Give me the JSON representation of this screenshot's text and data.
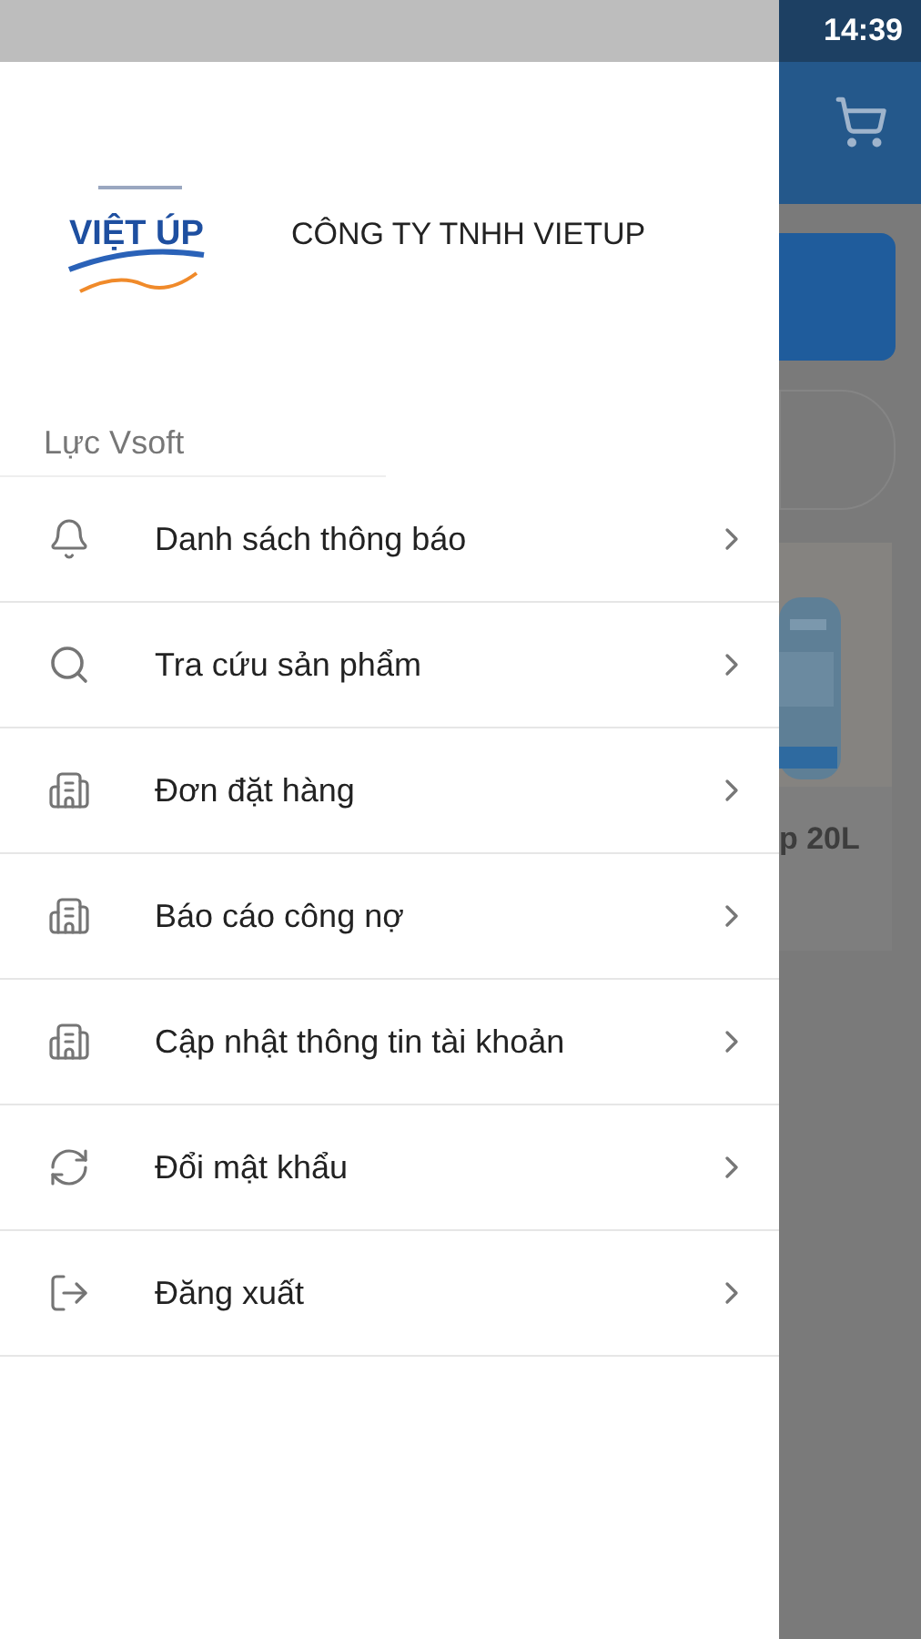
{
  "status_bar": {
    "time": "14:39"
  },
  "drawer": {
    "logo_text": "VIỆT ÚP",
    "company": "CÔNG TY TNHH VIETUP",
    "user": "Lực Vsoft",
    "menu": [
      {
        "label": "Danh sách thông báo",
        "kind": "bell"
      },
      {
        "label": "Tra cứu sản phẩm",
        "kind": "search"
      },
      {
        "label": "Đơn đặt hàng",
        "kind": "building"
      },
      {
        "label": "Báo cáo công nợ",
        "kind": "building"
      },
      {
        "label": "Cập nhật thông tin tài khoản",
        "kind": "building"
      },
      {
        "label": "Đổi mật khẩu",
        "kind": "sync"
      },
      {
        "label": "Đăng xuất",
        "kind": "logout"
      }
    ]
  },
  "background": {
    "product_name": "p 20L"
  }
}
